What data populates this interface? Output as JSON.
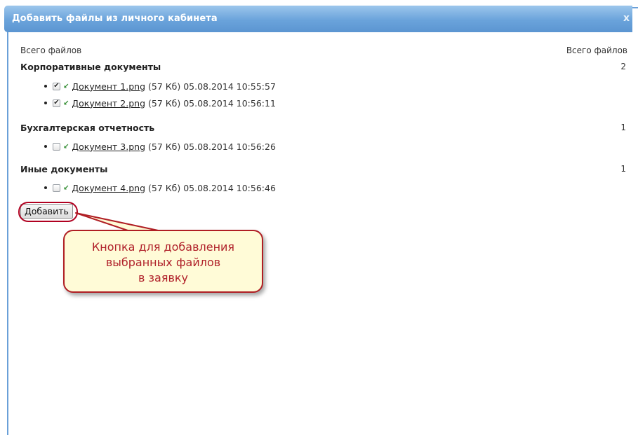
{
  "dialog": {
    "title": "Добавить файлы из личного кабинета",
    "close_label": "x"
  },
  "header": {
    "left_label": "Всего файлов",
    "right_label": "Всего файлов"
  },
  "categories": [
    {
      "name": "Корпоративные документы",
      "count": "2",
      "files": [
        {
          "link": "Документ 1.png",
          "meta": "(57 Кб) 05.08.2014 10:55:57",
          "checked": true
        },
        {
          "link": "Документ 2.png",
          "meta": "(57 Кб) 05.08.2014 10:56:11",
          "checked": true
        }
      ]
    },
    {
      "name": "Бухгалтерская отчетность",
      "count": "1",
      "files": [
        {
          "link": "Документ 3.png",
          "meta": "(57 Кб) 05.08.2014 10:56:26",
          "checked": false
        }
      ]
    },
    {
      "name": "Иные документы",
      "count": "1",
      "files": [
        {
          "link": "Документ 4.png",
          "meta": "(57 Кб) 05.08.2014 10:56:46",
          "checked": false
        }
      ]
    }
  ],
  "add_button_label": "Добавить",
  "callout": {
    "line1": "Кнопка для добавления",
    "line2": "выбранных файлов",
    "line3": "в заявку"
  },
  "colors": {
    "title_bar": "#6aa3db",
    "callout_border": "#b01e24",
    "callout_text": "#b0212a",
    "callout_fill": "#fffbd7",
    "download_arrow": "#2e8b2e"
  },
  "icons": {
    "download": "download-arrow-icon",
    "close": "close-icon"
  }
}
